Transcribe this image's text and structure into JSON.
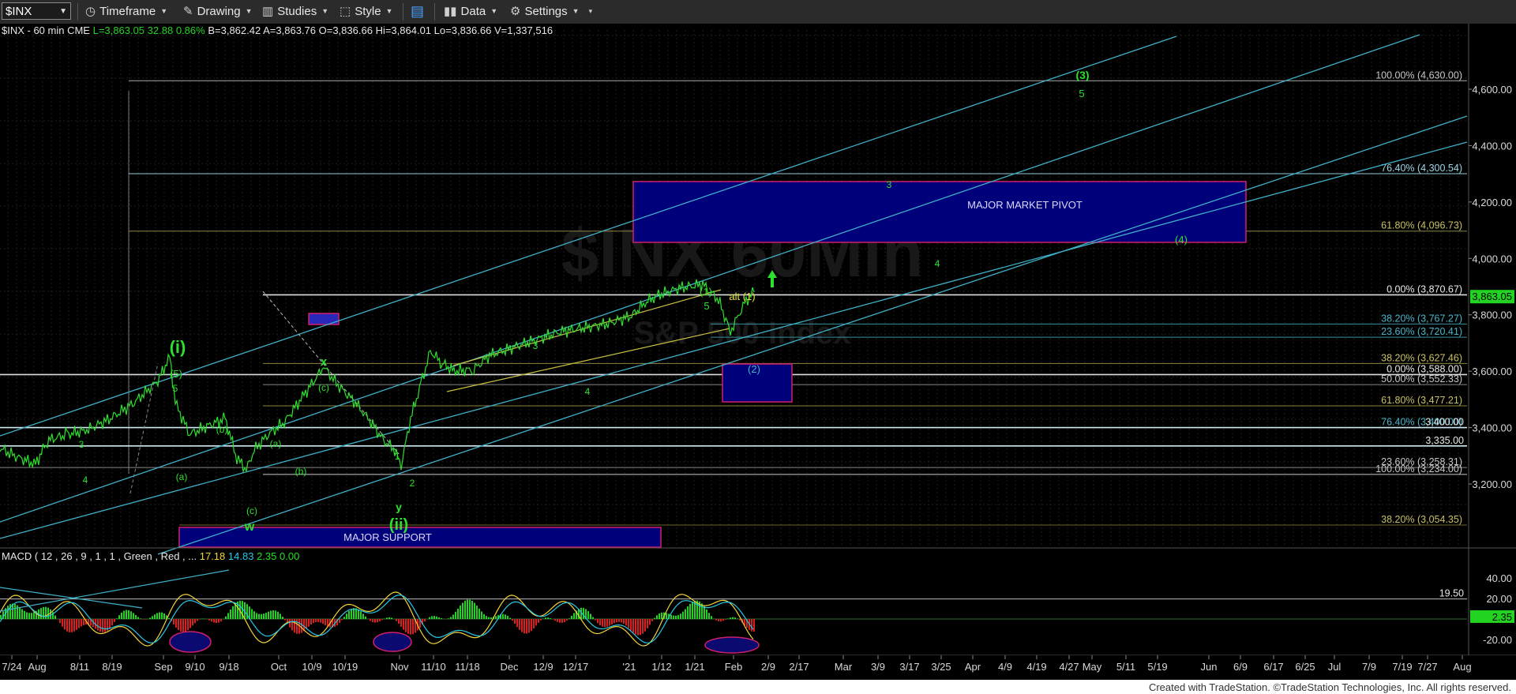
{
  "toolbar": {
    "symbol": "$INX",
    "items": [
      {
        "label": "Timeframe",
        "icon": "clock-icon"
      },
      {
        "label": "Drawing",
        "icon": "pencil-icon"
      },
      {
        "label": "Studies",
        "icon": "studies-icon"
      },
      {
        "label": "Style",
        "icon": "style-icon"
      },
      {
        "label": "",
        "icon": "layout-icon"
      },
      {
        "label": "Data",
        "icon": "data-bars-icon"
      },
      {
        "label": "Settings",
        "icon": "gear-icon"
      }
    ]
  },
  "quote": {
    "name": "$INX - 60 min  CME",
    "last": "L=3,863.05",
    "change": "32.88",
    "pct": "0.86%",
    "bid": "B=3,862.42",
    "ask": "A=3,863.76",
    "open": "O=3,836.66",
    "high": "Hi=3,864.01",
    "low": "Lo=3,836.66",
    "volume": "V=1,337,516"
  },
  "watermark": "$INX 60Min",
  "watermark2": "S&P 500 Index",
  "price_axis": {
    "ticks": [
      "4,600.00",
      "4,400.00",
      "4,200.00",
      "4,000.00",
      "3,800.00",
      "3,600.00",
      "3,400.00",
      "3,200.00"
    ],
    "last_price_label": "3,863.05",
    "level_labels": [
      "3,400.00",
      "3,335.00"
    ]
  },
  "fib_labels": [
    {
      "text": "100.00% (4,630.00)",
      "color": "#c8c8c8"
    },
    {
      "text": "76.40% (4,300.54)",
      "color": "#9fd6e6"
    },
    {
      "text": "61.80% (4,096.73)",
      "color": "#c8c064"
    },
    {
      "text": "0.00% (3,870.67)",
      "color": "#e8e8e8"
    },
    {
      "text": "38.20% (3,767.27)",
      "color": "#4bb3c8"
    },
    {
      "text": "23.60% (3,720.41)",
      "color": "#4bb3c8"
    },
    {
      "text": "38.20% (3,627.46)",
      "color": "#c8c064"
    },
    {
      "text": "0.00% (3,588.00)",
      "color": "#e8e8e8"
    },
    {
      "text": "50.00% (3,552.33)",
      "color": "#c8c8c8"
    },
    {
      "text": "61.80% (3,477.21)",
      "color": "#c8c064"
    },
    {
      "text": "76.40% (3,400.00)",
      "color": "#4bb3c8"
    },
    {
      "text": "23.60% (3,258.31)",
      "color": "#c8c8c8"
    },
    {
      "text": "100.00% (3,234.00)",
      "color": "#c8c8c8"
    },
    {
      "text": "38.20% (3,054.35)",
      "color": "#c8c064"
    }
  ],
  "boxes": {
    "pivot": "MAJOR MARKET PIVOT",
    "support": "MAJOR SUPPORT",
    "wave2": "(2)"
  },
  "wave_labels": {
    "green": [
      "(3)",
      "5",
      "3",
      "4",
      "(4)",
      "(1)",
      "5",
      "3",
      "4",
      "(i)",
      "(5)",
      "5",
      "3",
      "4",
      "(a)",
      "(b)",
      "(c)",
      "w",
      "x",
      "(c)",
      "(a)",
      "(b)",
      "1",
      "2",
      "y",
      "(ii)"
    ],
    "yellow": [
      "alt (1)"
    ]
  },
  "macd": {
    "title": "MACD ( 12 , 26 , 9 , 1 , 1 , Green , Red , ...",
    "v1": "17.18",
    "v2": "14.83",
    "v3": "2.35",
    "v4": "0.00",
    "axis": [
      "40.00",
      "20.00",
      "-20.00"
    ],
    "level_label": "19.50",
    "last_label": "2.35"
  },
  "x_axis": {
    "ticks": [
      "7/24",
      "Aug",
      "8/11",
      "8/19",
      "Sep",
      "9/10",
      "9/18",
      "Oct",
      "10/9",
      "10/19",
      "Nov",
      "11/10",
      "11/18",
      "Dec",
      "12/9",
      "12/17",
      "'21",
      "1/12",
      "1/21",
      "Feb",
      "2/9",
      "2/17",
      "Mar",
      "3/9",
      "3/17",
      "3/25",
      "Apr",
      "4/9",
      "4/19",
      "4/27",
      "May",
      "5/11",
      "5/19",
      "Jun",
      "6/9",
      "6/17",
      "6/25",
      "Jul",
      "7/9",
      "7/19",
      "7/27",
      "Aug"
    ]
  },
  "footer": "Created with TradeStation. ©TradeStation Technologies, Inc. All rights reserved.",
  "chart_data": {
    "type": "line",
    "title": "$INX - 60 min",
    "y_range": [
      3000,
      4760
    ],
    "series": [
      {
        "name": "",
        "x": [
          "7/24",
          "Aug",
          "8/11",
          "8/19",
          "Sep",
          "9/10",
          "9/18",
          "Oct",
          "10/9",
          "10/19",
          "Nov",
          "11/10",
          "11/18",
          "Dec",
          "12/9",
          "12/17",
          "'21",
          "1/12",
          "1/21",
          "Feb"
        ],
        "values": [
          3220,
          3280,
          3350,
          3390,
          3580,
          3360,
          3230,
          3330,
          3430,
          3520,
          3250,
          3590,
          3570,
          3620,
          3680,
          3700,
          3720,
          3800,
          3840,
          3863
        ]
      }
    ],
    "fib_levels": [
      4630.0,
      4300.54,
      4096.73,
      3870.67,
      3767.27,
      3720.41,
      3627.46,
      3588.0,
      3552.33,
      3477.21,
      3400.0,
      3335.0,
      3258.31,
      3234.0,
      3054.35
    ],
    "zones": [
      {
        "label": "MAJOR MARKET PIVOT",
        "from": "12/9",
        "to": "6/9",
        "low": 4096.73,
        "high": 4300.54
      },
      {
        "label": "MAJOR SUPPORT",
        "from": "Sep",
        "to": "12/9",
        "low": 3000,
        "high": 3054.35
      },
      {
        "label": "(2)",
        "from": "Feb",
        "to": "2/17",
        "low": 3477.21,
        "high": 3620
      }
    ],
    "macd": {
      "range": [
        -30,
        45
      ],
      "level": 19.5,
      "last": 2.35
    }
  }
}
